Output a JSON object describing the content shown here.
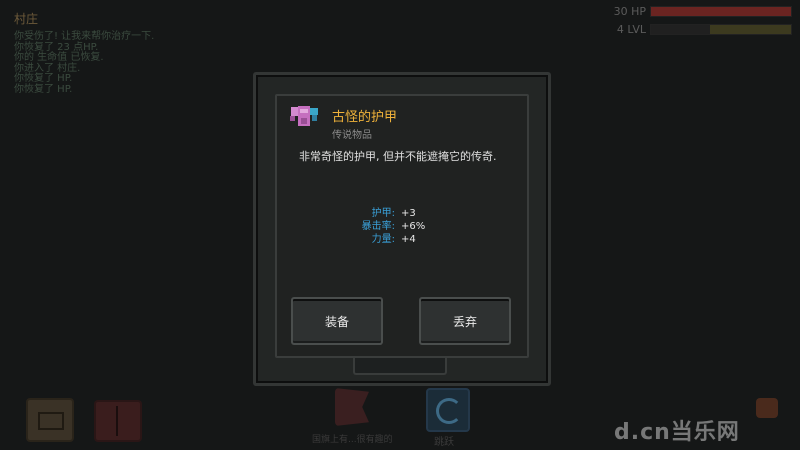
{
  "background": {
    "location": "村庄",
    "log": [
      "你受伤了! 让我来帮你治疗一下.",
      "你恢复了 23 点HP.",
      "你的 生命值 已恢复.",
      "你进入了 村庄.",
      "你恢复了 HP.",
      "你恢复了 HP."
    ],
    "hp_label": "30 HP",
    "hp_fraction": 1.0,
    "lvl_label": "4 LVL",
    "xp_fraction": 0.42,
    "flag_label": "国旗上有...很有趣的",
    "jump_label": "跳跃",
    "colors": {
      "hp_bar": "#6a2421",
      "accent_gold": "#f0b23a",
      "stat_key": "#3aa0d8"
    }
  },
  "dialog": {
    "item": {
      "icon": "armor-icon",
      "name": "古怪的护甲",
      "type": "传说物品",
      "description": "非常奇怪的护甲, 但并不能遮掩它的传奇."
    },
    "stats": [
      {
        "key": "护甲:",
        "value": "+3"
      },
      {
        "key": "暴击率:",
        "value": "+6%"
      },
      {
        "key": "力量:",
        "value": "+4"
      }
    ],
    "buttons": {
      "equip": "装备",
      "drop": "丢弃"
    }
  },
  "watermark": "d.cn当乐网"
}
